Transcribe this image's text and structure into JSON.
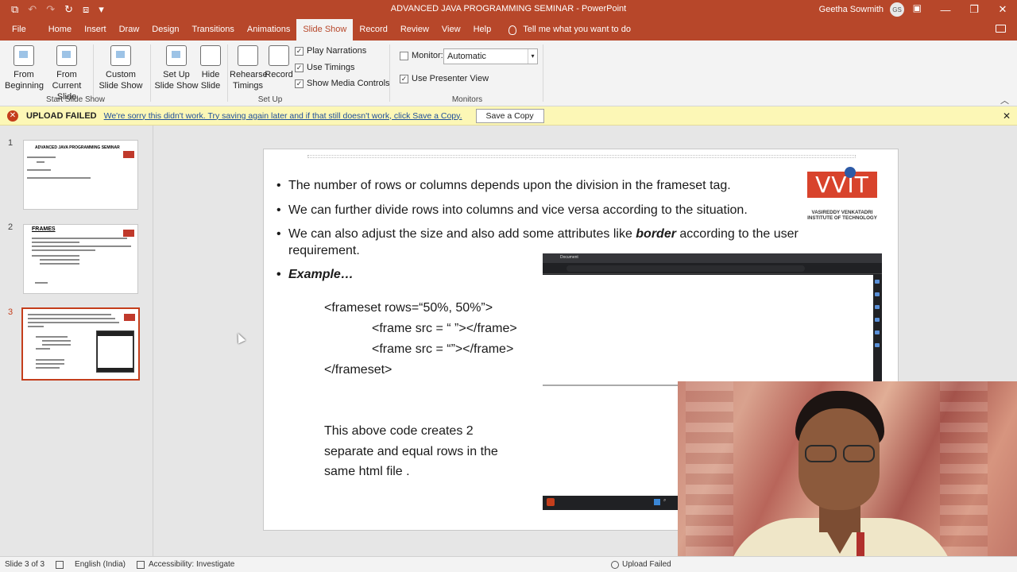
{
  "window": {
    "title": "ADVANCED JAVA PROGRAMMING SEMINAR  -  PowerPoint",
    "user_name": "Geetha Sowmith",
    "user_initials": "GS"
  },
  "tabs": [
    {
      "label": "File"
    },
    {
      "label": "Home"
    },
    {
      "label": "Insert"
    },
    {
      "label": "Draw"
    },
    {
      "label": "Design"
    },
    {
      "label": "Transitions"
    },
    {
      "label": "Animations"
    },
    {
      "label": "Slide Show",
      "active": true
    },
    {
      "label": "Record"
    },
    {
      "label": "Review"
    },
    {
      "label": "View"
    },
    {
      "label": "Help"
    }
  ],
  "tell_me": "Tell me what you want to do",
  "ribbon": {
    "from_beginning": "From Beginning",
    "from_current": "From Current Slide",
    "custom_show": "Custom Slide Show",
    "group_start": "Start Slide Show",
    "set_up_show": "Set Up Slide Show",
    "hide_slide": "Hide Slide",
    "rehearse": "Rehearse Timings",
    "record": "Record",
    "play_narrations": "Play Narrations",
    "use_timings": "Use Timings",
    "show_media": "Show Media Controls",
    "group_setup": "Set Up",
    "monitor_label": "Monitor:",
    "monitor_value": "Automatic",
    "presenter_view": "Use Presenter View",
    "group_monitors": "Monitors"
  },
  "message_bar": {
    "title": "UPLOAD FAILED",
    "text": "We're sorry this didn't work. Try saving again later and if that still doesn't work, click Save a Copy.",
    "button": "Save a Copy"
  },
  "thumbnails": [
    {
      "number": "1",
      "title": "ADVANCED JAVA PROGRAMMING SEMINAR"
    },
    {
      "number": "2",
      "title": "FRAMES"
    },
    {
      "number": "3",
      "title": ""
    }
  ],
  "slide": {
    "bullets": [
      "The number of rows or columns depends upon the division in the frameset tag.",
      "We can further divide rows into columns and vice versa according to the situation."
    ],
    "bullet3_pre": "We can also adjust the size and also add some attributes like ",
    "bullet3_bold": "border",
    "bullet3_post": "  according to the user requirement.",
    "example_label": "Example…",
    "code_lines": [
      "<frameset rows=“50%, 50%”>",
      "<frame src = “ ”></frame>",
      "<frame src = “”></frame>",
      "</frameset>"
    ],
    "description": "This above code creates 2 separate and equal rows in the same html file .",
    "logo_text": "VVIT",
    "logo_subtitle_1": "VASIREDDY VENKATADRI",
    "logo_subtitle_2": "INSTITUTE OF TECHNOLOGY",
    "browser_tab": "Document"
  },
  "status": {
    "slide_count": "Slide 3 of 3",
    "language": "English (India)",
    "accessibility": "Accessibility: Investigate",
    "upload": "Upload Failed"
  }
}
